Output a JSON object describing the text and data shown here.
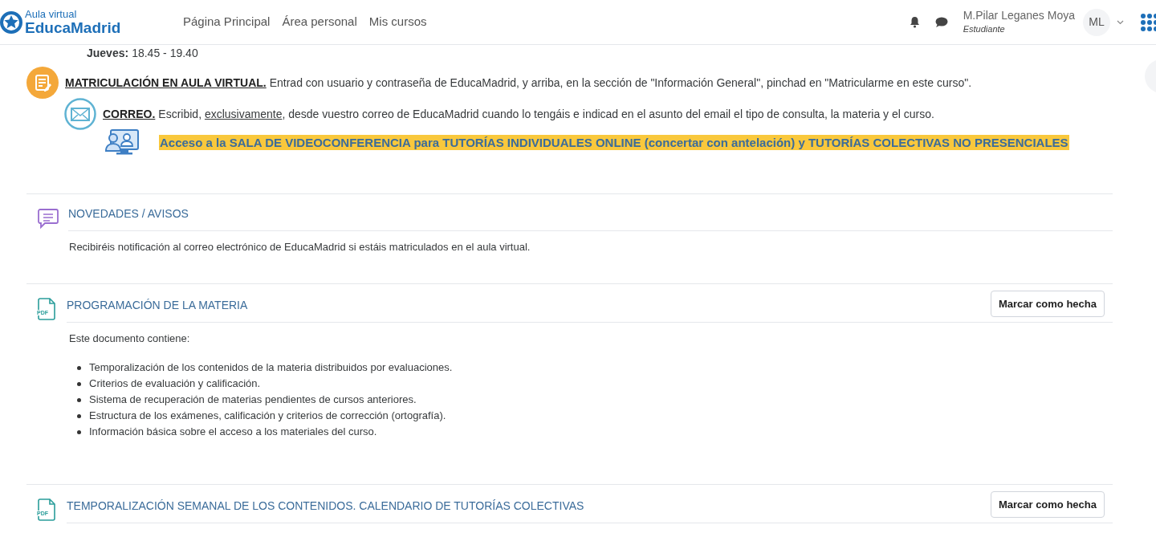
{
  "header": {
    "logo": {
      "line1": "Aula virtual",
      "line2": "EducaMadrid"
    },
    "nav": [
      {
        "label": "Página Principal"
      },
      {
        "label": "Área personal"
      },
      {
        "label": "Mis cursos"
      }
    ],
    "user": {
      "name": "M.Pilar Leganes Moya",
      "role": "Estudiante",
      "initials": "ML"
    }
  },
  "schedule_line": {
    "day": "Jueves:",
    "time": "18.45 - 19.40"
  },
  "notices": [
    {
      "kind": "enrol",
      "lead": "MATRICULACIÓN EN AULA VIRTUAL.",
      "text": [
        "Entrad con usuario y contraseña de EducaMadrid, y arriba, en la sección de \"Información General\", pinchad en \"Matricularme en este curso\"."
      ]
    },
    {
      "kind": "mail",
      "lead": "CORREO.",
      "text": [
        "Escribid, ",
        "exclusivamente",
        ", desde vuestro correo de EducaMadrid cuando lo tengáis e indicad en el asunto del email el tipo de consulta, la materia y el curso."
      ]
    },
    {
      "kind": "video",
      "link": "Acceso a la SALA DE VIDEOCONFERENCIA para TUTORÍAS INDIVIDUALES ONLINE (concertar con antelación) y TUTORÍAS COLECTIVAS NO PRESENCIALES"
    }
  ],
  "activities": [
    {
      "kind": "forum",
      "title": "NOVEDADES / AVISOS",
      "description": "Recibiréis notificación al correo electrónico de EducaMadrid si estáis matriculados en el aula virtual."
    },
    {
      "kind": "pdf",
      "icon_text": "PDF",
      "title": "PROGRAMACIÓN DE LA MATERIA",
      "completion_button": "Marcar como hecha",
      "description": "Este documento contiene:",
      "bullets": [
        "Temporalización de los contenidos de la materia distribuidos por evaluaciones.",
        "Criterios de evaluación y calificación.",
        "Sistema de recuperación de materias pendientes de cursos anteriores.",
        "Estructura de los exámenes, calificación y criterios de corrección (ortografía).",
        "Información básica sobre el acceso a los materiales del curso."
      ]
    },
    {
      "kind": "pdf",
      "icon_text": "PDF",
      "title": "TEMPORALIZACIÓN SEMANAL DE LOS CONTENIDOS. CALENDARIO DE TUTORÍAS COLECTIVAS",
      "completion_button": "Marcar como hecha"
    }
  ]
}
